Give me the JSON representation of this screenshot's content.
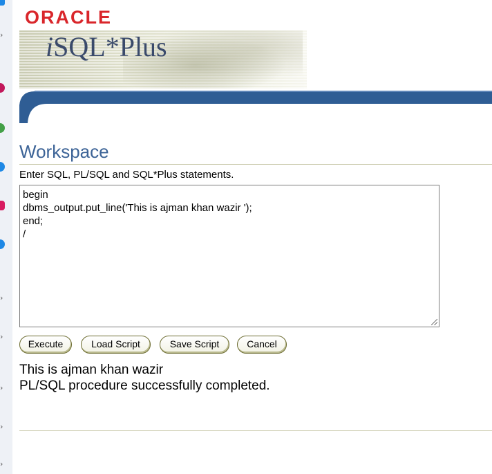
{
  "header": {
    "brand": "ORACLE",
    "app_prefix": "i",
    "app_name": "SQL*Plus"
  },
  "workspace": {
    "title": "Workspace",
    "instructions": "Enter SQL, PL/SQL and SQL*Plus statements.",
    "sql_lines": [
      "begin",
      "dbms_output.put_line('This is ajman khan wazir ');",
      "end;",
      "/"
    ]
  },
  "buttons": {
    "execute": "Execute",
    "load_script": "Load Script",
    "save_script": "Save Script",
    "cancel": "Cancel"
  },
  "output": {
    "lines": [
      "This is ajman khan wazir",
      "PL/SQL procedure successfully completed."
    ]
  },
  "colors": {
    "brand_red": "#d9262b",
    "accent_blue": "#3d6497",
    "bar_blue": "#2f5d94"
  }
}
